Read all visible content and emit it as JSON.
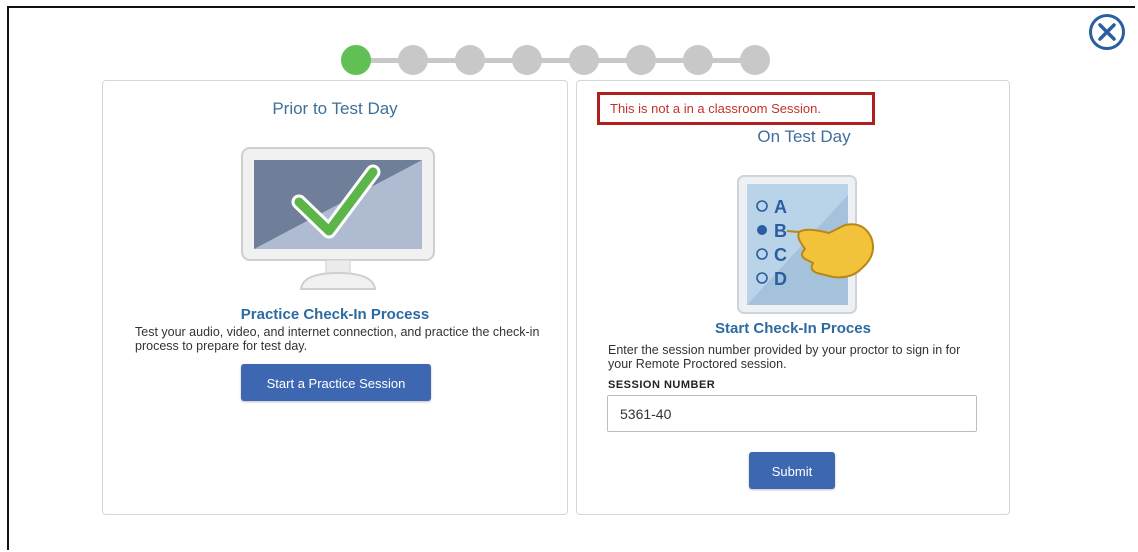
{
  "steps": {
    "total": 8,
    "active_index": 0
  },
  "colors": {
    "step_active": "#61c054",
    "step_inactive": "#c8c8c8",
    "accent": "#3e67b2",
    "notice_border": "#b01e1e"
  },
  "left_panel": {
    "title": "Prior to Test Day",
    "illustration": "monitor-checkmark-icon",
    "heading": "Practice Check-In Process",
    "description": "Test your audio, video, and internet connection, and practice the check-in process to prepare for test day.",
    "button_label": "Start a Practice Session"
  },
  "right_panel": {
    "notice": "This is not a in a classroom Session.",
    "title": "On Test Day",
    "illustration": "answer-sheet-hand-icon",
    "options": [
      "A",
      "B",
      "C",
      "D"
    ],
    "selected_option": "B",
    "heading": "Start Check-In Proces",
    "description": "Enter the session number provided by your proctor to sign in for your Remote Proctored session.",
    "field_label": "SESSION NUMBER",
    "session_number": "5361-40",
    "submit_label": "Submit"
  },
  "close_icon": "close-circle-icon"
}
